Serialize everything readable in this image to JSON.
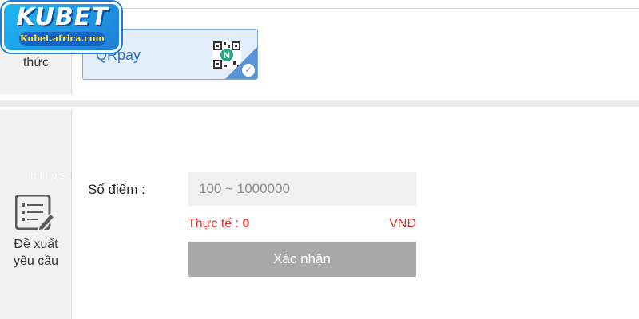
{
  "logo": {
    "wordmark": "KUBET",
    "site": "Kubet.africa.com"
  },
  "payment_method": {
    "side_label": "thức",
    "options": [
      {
        "label": "QRpay",
        "selected": true,
        "icon": "qr-code-icon"
      }
    ]
  },
  "request": {
    "side_label_line1": "Đề xuất",
    "side_label_line2": "yêu cầu",
    "side_icon": "edit-document-icon",
    "watermark": "https:",
    "points_label": "Số điểm :",
    "points_placeholder": "100 ~ 1000000",
    "points_value": "",
    "actual_label": "Thực tế : ",
    "actual_value": "0",
    "currency": "VNĐ",
    "confirm_label": "Xác nhận"
  },
  "colors": {
    "accent": "#2f72c4",
    "warning": "#d9342b",
    "button_disabled": "#a9a9a9"
  }
}
